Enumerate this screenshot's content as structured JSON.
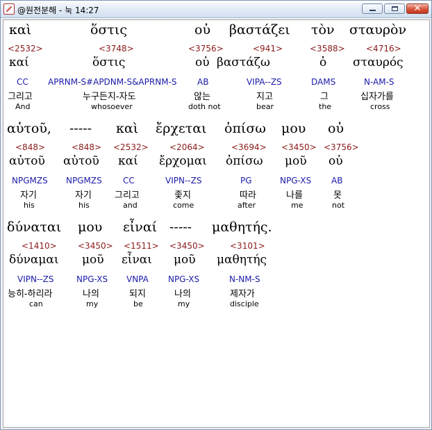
{
  "window": {
    "title": "@원전분해 - 눅 14:27"
  },
  "lines": [
    [
      {
        "greek": "καὶ",
        "strong": "<2532>",
        "lemma": "καί",
        "parse": "CC",
        "korean": "그리고",
        "english": "And"
      },
      {
        "greek": "ὅστις",
        "strong": "<3748>",
        "lemma": "ὅστις",
        "parse": "APRNM-S#APDNM-S&APRNM-S",
        "korean": "누구든지-자도",
        "english": "whosoever"
      },
      {
        "greek": "οὐ",
        "strong": "<3756>",
        "lemma": "οὐ",
        "parse": "AB",
        "korean": "않는",
        "english": "doth not"
      },
      {
        "greek": "βαστάζει",
        "strong": "<941>",
        "lemma": "βαστάζω",
        "parse": "VIPA--ZS",
        "korean": "지고",
        "english": "bear"
      },
      {
        "greek": "τὸν",
        "strong": "<3588>",
        "lemma": "ὁ",
        "parse": "DAMS",
        "korean": "그",
        "english": "the"
      },
      {
        "greek": "σταυρὸν",
        "strong": "<4716>",
        "lemma": "σταυρός",
        "parse": "N-AM-S",
        "korean": "십자가를",
        "english": "cross"
      }
    ],
    [
      {
        "greek": "αὐτοῦ,",
        "strong": "<848>",
        "lemma": "αὐτοῦ",
        "parse": "NPGMZS",
        "korean": "자기",
        "english": "his"
      },
      {
        "greek": "-----",
        "strong": "<848>",
        "lemma": "αὐτοῦ",
        "parse": "NPGMZS",
        "korean": "자기",
        "english": "his"
      },
      {
        "greek": "καὶ",
        "strong": "<2532>",
        "lemma": "καί",
        "parse": "CC",
        "korean": "그리고",
        "english": "and"
      },
      {
        "greek": "ἔρχεται",
        "strong": "<2064>",
        "lemma": "ἔρχομαι",
        "parse": "VIPN--ZS",
        "korean": "좇지",
        "english": "come"
      },
      {
        "greek": "ὀπίσω",
        "strong": "<3694>",
        "lemma": "ὀπίσω",
        "parse": "PG",
        "korean": "따라",
        "english": "after"
      },
      {
        "greek": "μου",
        "strong": "<3450>",
        "lemma": "μοῦ",
        "parse": "NPG-XS",
        "korean": "나를",
        "english": "me"
      },
      {
        "greek": "οὐ",
        "strong": "<3756>",
        "lemma": "οὐ",
        "parse": "AB",
        "korean": "못",
        "english": "not"
      }
    ],
    [
      {
        "greek": "δύναται",
        "strong": "<1410>",
        "lemma": "δύναμαι",
        "parse": "VIPN--ZS",
        "korean": "능히-하리라",
        "english": "can"
      },
      {
        "greek": "μου",
        "strong": "<3450>",
        "lemma": "μοῦ",
        "parse": "NPG-XS",
        "korean": "나의",
        "english": "my"
      },
      {
        "greek": "εἶναί",
        "strong": "<1511>",
        "lemma": "εἶναι",
        "parse": "VNPA",
        "korean": "되지",
        "english": "be"
      },
      {
        "greek": "-----",
        "strong": "<3450>",
        "lemma": "μοῦ",
        "parse": "NPG-XS",
        "korean": "나의",
        "english": "my"
      },
      {
        "greek": "μαθητής.",
        "strong": "<3101>",
        "lemma": "μαθητής",
        "parse": "N-NM-S",
        "korean": "제자가",
        "english": "disciple"
      }
    ]
  ]
}
